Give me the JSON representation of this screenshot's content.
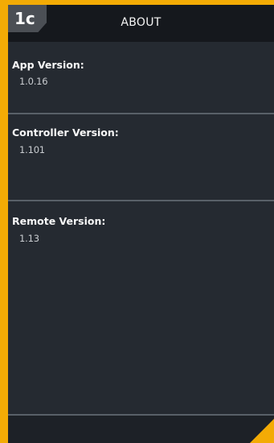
{
  "screen": {
    "badge": "1c",
    "title": "ABOUT"
  },
  "versions": [
    {
      "label": "App Version:",
      "value": "1.0.16"
    },
    {
      "label": "Controller Version:",
      "value": "1.101"
    },
    {
      "label": "Remote Version:",
      "value": "1.13"
    }
  ],
  "colors": {
    "frame": "#f3ab05",
    "screen_bg": "#252a31",
    "header_bg": "#15181d",
    "divider": "#596068",
    "badge_bg": "#4b4f55"
  }
}
